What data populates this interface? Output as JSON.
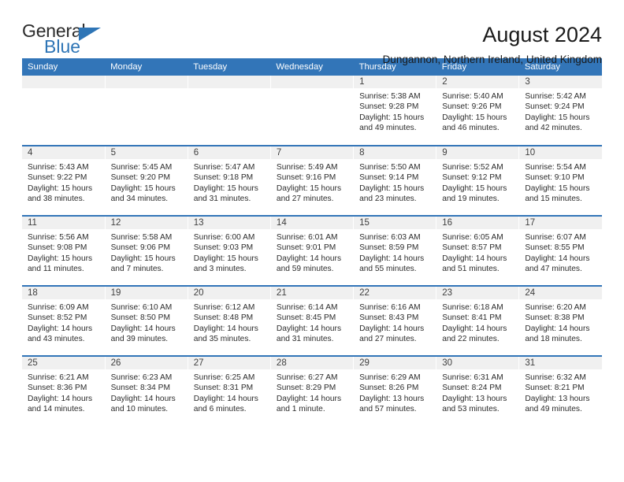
{
  "logo": {
    "word_top": "General",
    "word_bottom": "Blue",
    "triangle_color": "#2e75b6"
  },
  "header": {
    "title": "August 2024",
    "subtitle": "Dungannon, Northern Ireland, United Kingdom",
    "accent_color": "#3275b8"
  },
  "weekday_headers": [
    "Sunday",
    "Monday",
    "Tuesday",
    "Wednesday",
    "Thursday",
    "Friday",
    "Saturday"
  ],
  "labels": {
    "sunrise": "Sunrise:",
    "sunset": "Sunset:",
    "daylight": "Daylight:"
  },
  "weeks": [
    [
      {
        "empty": true
      },
      {
        "empty": true
      },
      {
        "empty": true
      },
      {
        "empty": true
      },
      {
        "day": "1",
        "sunrise": "Sunrise: 5:38 AM",
        "sunset": "Sunset: 9:28 PM",
        "daylight_1": "Daylight: 15 hours",
        "daylight_2": "and 49 minutes."
      },
      {
        "day": "2",
        "sunrise": "Sunrise: 5:40 AM",
        "sunset": "Sunset: 9:26 PM",
        "daylight_1": "Daylight: 15 hours",
        "daylight_2": "and 46 minutes."
      },
      {
        "day": "3",
        "sunrise": "Sunrise: 5:42 AM",
        "sunset": "Sunset: 9:24 PM",
        "daylight_1": "Daylight: 15 hours",
        "daylight_2": "and 42 minutes."
      }
    ],
    [
      {
        "day": "4",
        "sunrise": "Sunrise: 5:43 AM",
        "sunset": "Sunset: 9:22 PM",
        "daylight_1": "Daylight: 15 hours",
        "daylight_2": "and 38 minutes."
      },
      {
        "day": "5",
        "sunrise": "Sunrise: 5:45 AM",
        "sunset": "Sunset: 9:20 PM",
        "daylight_1": "Daylight: 15 hours",
        "daylight_2": "and 34 minutes."
      },
      {
        "day": "6",
        "sunrise": "Sunrise: 5:47 AM",
        "sunset": "Sunset: 9:18 PM",
        "daylight_1": "Daylight: 15 hours",
        "daylight_2": "and 31 minutes."
      },
      {
        "day": "7",
        "sunrise": "Sunrise: 5:49 AM",
        "sunset": "Sunset: 9:16 PM",
        "daylight_1": "Daylight: 15 hours",
        "daylight_2": "and 27 minutes."
      },
      {
        "day": "8",
        "sunrise": "Sunrise: 5:50 AM",
        "sunset": "Sunset: 9:14 PM",
        "daylight_1": "Daylight: 15 hours",
        "daylight_2": "and 23 minutes."
      },
      {
        "day": "9",
        "sunrise": "Sunrise: 5:52 AM",
        "sunset": "Sunset: 9:12 PM",
        "daylight_1": "Daylight: 15 hours",
        "daylight_2": "and 19 minutes."
      },
      {
        "day": "10",
        "sunrise": "Sunrise: 5:54 AM",
        "sunset": "Sunset: 9:10 PM",
        "daylight_1": "Daylight: 15 hours",
        "daylight_2": "and 15 minutes."
      }
    ],
    [
      {
        "day": "11",
        "sunrise": "Sunrise: 5:56 AM",
        "sunset": "Sunset: 9:08 PM",
        "daylight_1": "Daylight: 15 hours",
        "daylight_2": "and 11 minutes."
      },
      {
        "day": "12",
        "sunrise": "Sunrise: 5:58 AM",
        "sunset": "Sunset: 9:06 PM",
        "daylight_1": "Daylight: 15 hours",
        "daylight_2": "and 7 minutes."
      },
      {
        "day": "13",
        "sunrise": "Sunrise: 6:00 AM",
        "sunset": "Sunset: 9:03 PM",
        "daylight_1": "Daylight: 15 hours",
        "daylight_2": "and 3 minutes."
      },
      {
        "day": "14",
        "sunrise": "Sunrise: 6:01 AM",
        "sunset": "Sunset: 9:01 PM",
        "daylight_1": "Daylight: 14 hours",
        "daylight_2": "and 59 minutes."
      },
      {
        "day": "15",
        "sunrise": "Sunrise: 6:03 AM",
        "sunset": "Sunset: 8:59 PM",
        "daylight_1": "Daylight: 14 hours",
        "daylight_2": "and 55 minutes."
      },
      {
        "day": "16",
        "sunrise": "Sunrise: 6:05 AM",
        "sunset": "Sunset: 8:57 PM",
        "daylight_1": "Daylight: 14 hours",
        "daylight_2": "and 51 minutes."
      },
      {
        "day": "17",
        "sunrise": "Sunrise: 6:07 AM",
        "sunset": "Sunset: 8:55 PM",
        "daylight_1": "Daylight: 14 hours",
        "daylight_2": "and 47 minutes."
      }
    ],
    [
      {
        "day": "18",
        "sunrise": "Sunrise: 6:09 AM",
        "sunset": "Sunset: 8:52 PM",
        "daylight_1": "Daylight: 14 hours",
        "daylight_2": "and 43 minutes."
      },
      {
        "day": "19",
        "sunrise": "Sunrise: 6:10 AM",
        "sunset": "Sunset: 8:50 PM",
        "daylight_1": "Daylight: 14 hours",
        "daylight_2": "and 39 minutes."
      },
      {
        "day": "20",
        "sunrise": "Sunrise: 6:12 AM",
        "sunset": "Sunset: 8:48 PM",
        "daylight_1": "Daylight: 14 hours",
        "daylight_2": "and 35 minutes."
      },
      {
        "day": "21",
        "sunrise": "Sunrise: 6:14 AM",
        "sunset": "Sunset: 8:45 PM",
        "daylight_1": "Daylight: 14 hours",
        "daylight_2": "and 31 minutes."
      },
      {
        "day": "22",
        "sunrise": "Sunrise: 6:16 AM",
        "sunset": "Sunset: 8:43 PM",
        "daylight_1": "Daylight: 14 hours",
        "daylight_2": "and 27 minutes."
      },
      {
        "day": "23",
        "sunrise": "Sunrise: 6:18 AM",
        "sunset": "Sunset: 8:41 PM",
        "daylight_1": "Daylight: 14 hours",
        "daylight_2": "and 22 minutes."
      },
      {
        "day": "24",
        "sunrise": "Sunrise: 6:20 AM",
        "sunset": "Sunset: 8:38 PM",
        "daylight_1": "Daylight: 14 hours",
        "daylight_2": "and 18 minutes."
      }
    ],
    [
      {
        "day": "25",
        "sunrise": "Sunrise: 6:21 AM",
        "sunset": "Sunset: 8:36 PM",
        "daylight_1": "Daylight: 14 hours",
        "daylight_2": "and 14 minutes."
      },
      {
        "day": "26",
        "sunrise": "Sunrise: 6:23 AM",
        "sunset": "Sunset: 8:34 PM",
        "daylight_1": "Daylight: 14 hours",
        "daylight_2": "and 10 minutes."
      },
      {
        "day": "27",
        "sunrise": "Sunrise: 6:25 AM",
        "sunset": "Sunset: 8:31 PM",
        "daylight_1": "Daylight: 14 hours",
        "daylight_2": "and 6 minutes."
      },
      {
        "day": "28",
        "sunrise": "Sunrise: 6:27 AM",
        "sunset": "Sunset: 8:29 PM",
        "daylight_1": "Daylight: 14 hours",
        "daylight_2": "and 1 minute."
      },
      {
        "day": "29",
        "sunrise": "Sunrise: 6:29 AM",
        "sunset": "Sunset: 8:26 PM",
        "daylight_1": "Daylight: 13 hours",
        "daylight_2": "and 57 minutes."
      },
      {
        "day": "30",
        "sunrise": "Sunrise: 6:31 AM",
        "sunset": "Sunset: 8:24 PM",
        "daylight_1": "Daylight: 13 hours",
        "daylight_2": "and 53 minutes."
      },
      {
        "day": "31",
        "sunrise": "Sunrise: 6:32 AM",
        "sunset": "Sunset: 8:21 PM",
        "daylight_1": "Daylight: 13 hours",
        "daylight_2": "and 49 minutes."
      }
    ]
  ]
}
